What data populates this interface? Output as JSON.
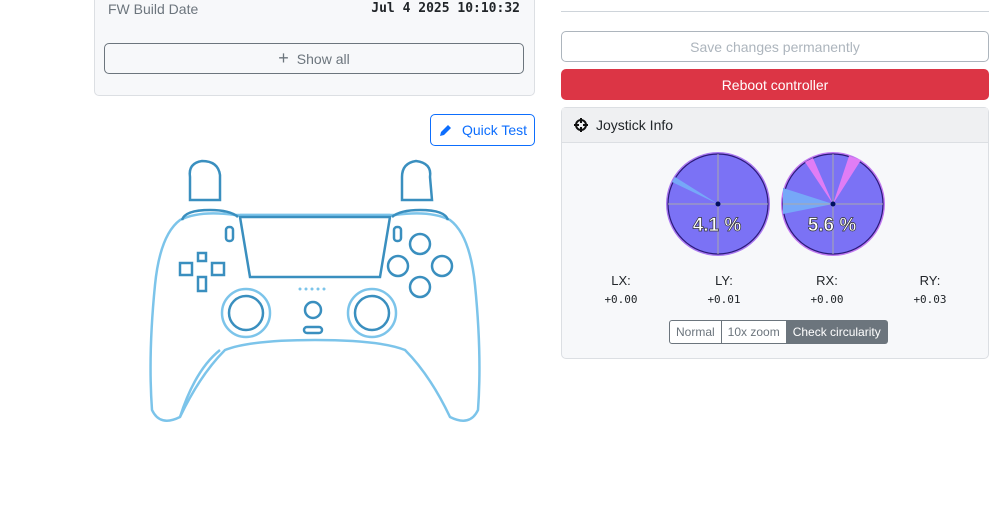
{
  "info": {
    "fw_build_label": "FW Build Date",
    "fw_build_value": "Jul 4 2025 10:10:32",
    "show_all": "Show all"
  },
  "quick_test": "Quick Test",
  "actions": {
    "save": "Save changes permanently",
    "reboot": "Reboot controller"
  },
  "joystick": {
    "title": "Joystick Info",
    "left_circularity": "4.1 %",
    "right_circularity": "5.6 %",
    "axes": [
      {
        "name": "LX:",
        "value": "+0.00"
      },
      {
        "name": "LY:",
        "value": "+0.01"
      },
      {
        "name": "RX:",
        "value": "+0.00"
      },
      {
        "name": "RY:",
        "value": "+0.03"
      }
    ],
    "modes": [
      "Normal",
      "10x zoom",
      "Check circularity"
    ],
    "active_mode": "Check circularity"
  },
  "colors": {
    "danger": "#dc3545",
    "primary": "#0d6efd",
    "controller": "#7cc4ea"
  }
}
